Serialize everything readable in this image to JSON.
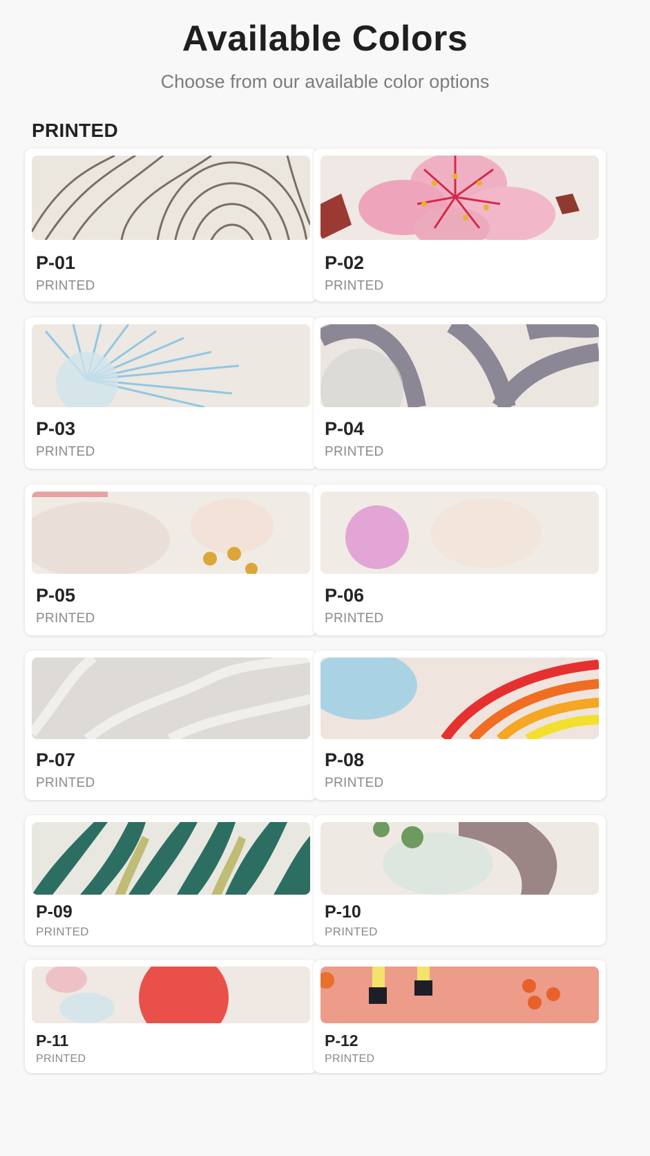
{
  "header": {
    "title": "Available Colors",
    "subtitle": "Choose from our available color options"
  },
  "section": {
    "title": "PRINTED"
  },
  "items": [
    {
      "code": "P-01",
      "type": "PRINTED"
    },
    {
      "code": "P-02",
      "type": "PRINTED"
    },
    {
      "code": "P-03",
      "type": "PRINTED"
    },
    {
      "code": "P-04",
      "type": "PRINTED"
    },
    {
      "code": "P-05",
      "type": "PRINTED"
    },
    {
      "code": "P-06",
      "type": "PRINTED"
    },
    {
      "code": "P-07",
      "type": "PRINTED"
    },
    {
      "code": "P-08",
      "type": "PRINTED"
    },
    {
      "code": "P-09",
      "type": "PRINTED"
    },
    {
      "code": "P-10",
      "type": "PRINTED"
    },
    {
      "code": "P-11",
      "type": "PRINTED"
    },
    {
      "code": "P-12",
      "type": "PRINTED"
    }
  ],
  "colors": {
    "background": "#f8f8f8",
    "card": "#ffffff",
    "text": "#222222",
    "muted": "#8a8a8a"
  }
}
